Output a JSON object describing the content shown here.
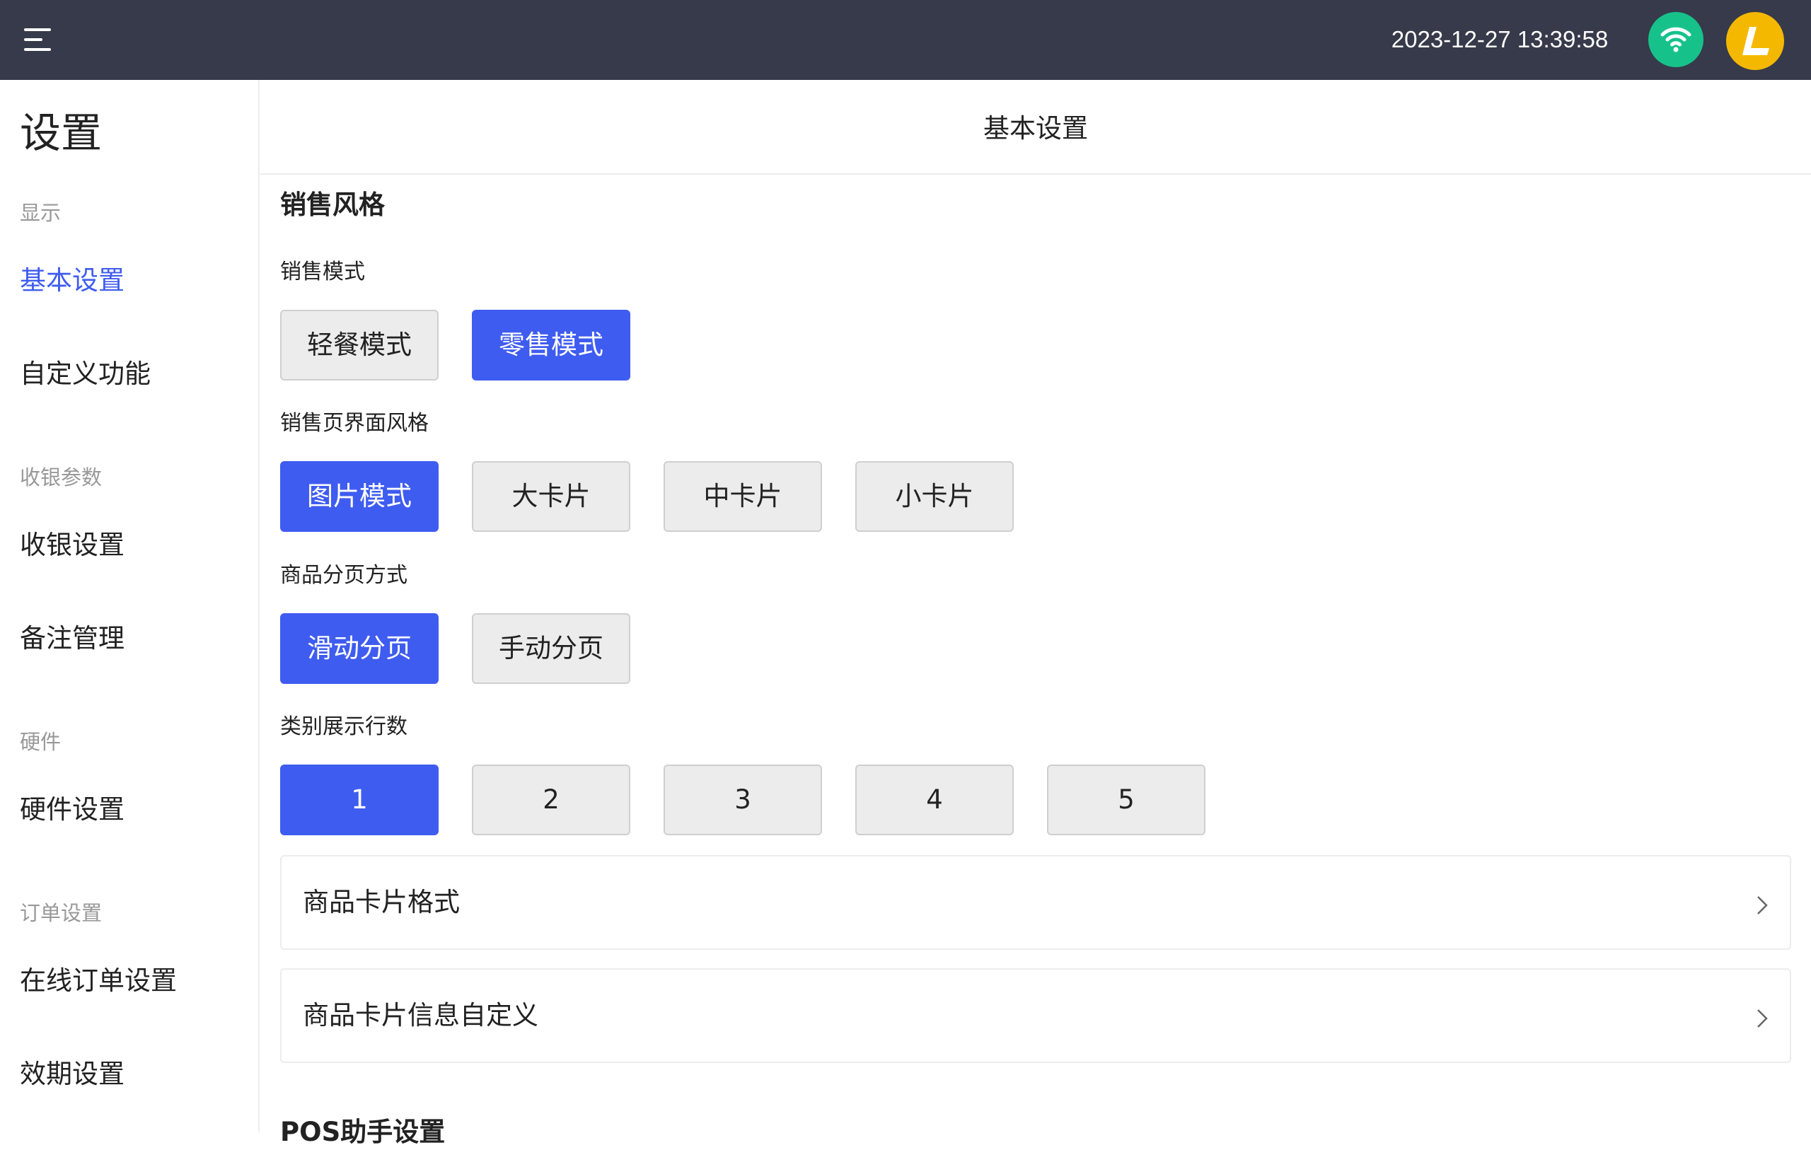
{
  "topbar": {
    "datetime": "2023-12-27 13:39:58",
    "menu_icon": "hamburger-menu-icon",
    "wifi_icon": "wifi-icon",
    "avatar_icon": "app-logo-icon",
    "colors": {
      "bar": "#363a4a",
      "wifi": "#17c28a",
      "avatar": "#f5b800"
    }
  },
  "sidebar": {
    "title": "设置",
    "groups": [
      {
        "label": "显示",
        "items": [
          {
            "label": "基本设置",
            "active": true
          },
          {
            "label": "自定义功能"
          }
        ]
      },
      {
        "label": "收银参数",
        "items": [
          {
            "label": "收银设置"
          },
          {
            "label": "备注管理"
          }
        ]
      },
      {
        "label": "硬件",
        "items": [
          {
            "label": "硬件设置"
          }
        ]
      },
      {
        "label": "订单设置",
        "items": [
          {
            "label": "在线订单设置"
          },
          {
            "label": "效期设置"
          }
        ]
      }
    ],
    "active_color": "#3f5cf0"
  },
  "main": {
    "title": "基本设置",
    "section_title": "销售风格",
    "sales_mode": {
      "label": "销售模式",
      "options": [
        "轻餐模式",
        "零售模式"
      ],
      "selected": "零售模式"
    },
    "page_style": {
      "label": "销售页界面风格",
      "options": [
        "图片模式",
        "大卡片",
        "中卡片",
        "小卡片"
      ],
      "selected": "图片模式"
    },
    "paging": {
      "label": "商品分页方式",
      "options": [
        "滑动分页",
        "手动分页"
      ],
      "selected": "滑动分页"
    },
    "category_rows": {
      "label": "类别展示行数",
      "options": [
        "1",
        "2",
        "3",
        "4",
        "5"
      ],
      "selected": "1"
    },
    "links": [
      {
        "label": "商品卡片格式",
        "icon": "chevron-right-icon"
      },
      {
        "label": "商品卡片信息自定义",
        "icon": "chevron-right-icon"
      }
    ],
    "next_section_title": "POS助手设置",
    "accent_color": "#3f5cf0"
  }
}
